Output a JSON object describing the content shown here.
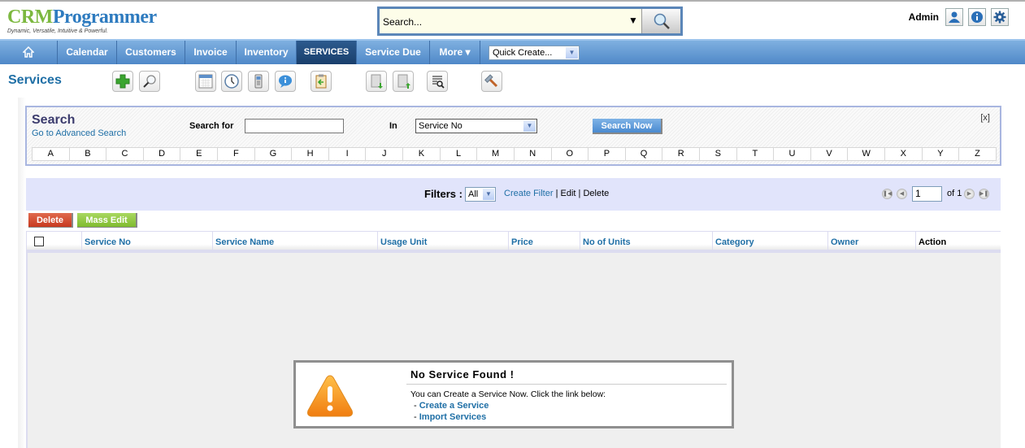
{
  "brand": {
    "part1": "CRM",
    "part2": "Programmer",
    "tagline": "Dynamic, Versatile, Intuitive & Powerful."
  },
  "global_search": {
    "placeholder": "Search...",
    "value": "Search..."
  },
  "user": {
    "name": "Admin",
    "icons": [
      "user-icon",
      "info-icon",
      "gear-icon"
    ]
  },
  "nav": {
    "items": [
      {
        "label": "Calendar"
      },
      {
        "label": "Customers"
      },
      {
        "label": "Invoice"
      },
      {
        "label": "Inventory"
      },
      {
        "label": "SERVICES",
        "active": true
      },
      {
        "label": "Service Due"
      },
      {
        "label": "More ▾"
      }
    ],
    "quick_create": "Quick Create..."
  },
  "page": {
    "title": "Services"
  },
  "toolbar": {
    "icons": [
      "add-icon",
      "search-icon",
      "calendar-icon",
      "clock-icon",
      "calculator-icon",
      "chat-icon",
      "clipboard-icon",
      "import-icon",
      "export-icon",
      "find-duplicates-icon",
      "settings-hammer-icon"
    ]
  },
  "search": {
    "title": "Search",
    "advanced_link": "Go to Advanced Search",
    "search_for_label": "Search for",
    "search_for_value": "",
    "in_label": "In",
    "in_value": "Service No",
    "button": "Search Now",
    "close": "[x]",
    "alphabet": [
      "A",
      "B",
      "C",
      "D",
      "E",
      "F",
      "G",
      "H",
      "I",
      "J",
      "K",
      "L",
      "M",
      "N",
      "O",
      "P",
      "Q",
      "R",
      "S",
      "T",
      "U",
      "V",
      "W",
      "X",
      "Y",
      "Z"
    ]
  },
  "filters": {
    "label": "Filters :",
    "selected": "All",
    "create": "Create Filter",
    "sep1": " | ",
    "edit": "Edit",
    "sep2": " | ",
    "delete": "Delete",
    "page": "1",
    "of": "of 1"
  },
  "actions": {
    "delete": "Delete",
    "mass_edit": "Mass Edit"
  },
  "table": {
    "columns": [
      "Service No",
      "Service Name",
      "Usage Unit",
      "Price",
      "No of Units",
      "Category",
      "Owner",
      "Action"
    ]
  },
  "empty_state": {
    "title": "No Service Found !",
    "message": "You can Create a Service Now. Click the link below:",
    "link1_prefix": "- ",
    "link1": "Create a Service",
    "link2_prefix": "- ",
    "link2": "Import Services"
  }
}
